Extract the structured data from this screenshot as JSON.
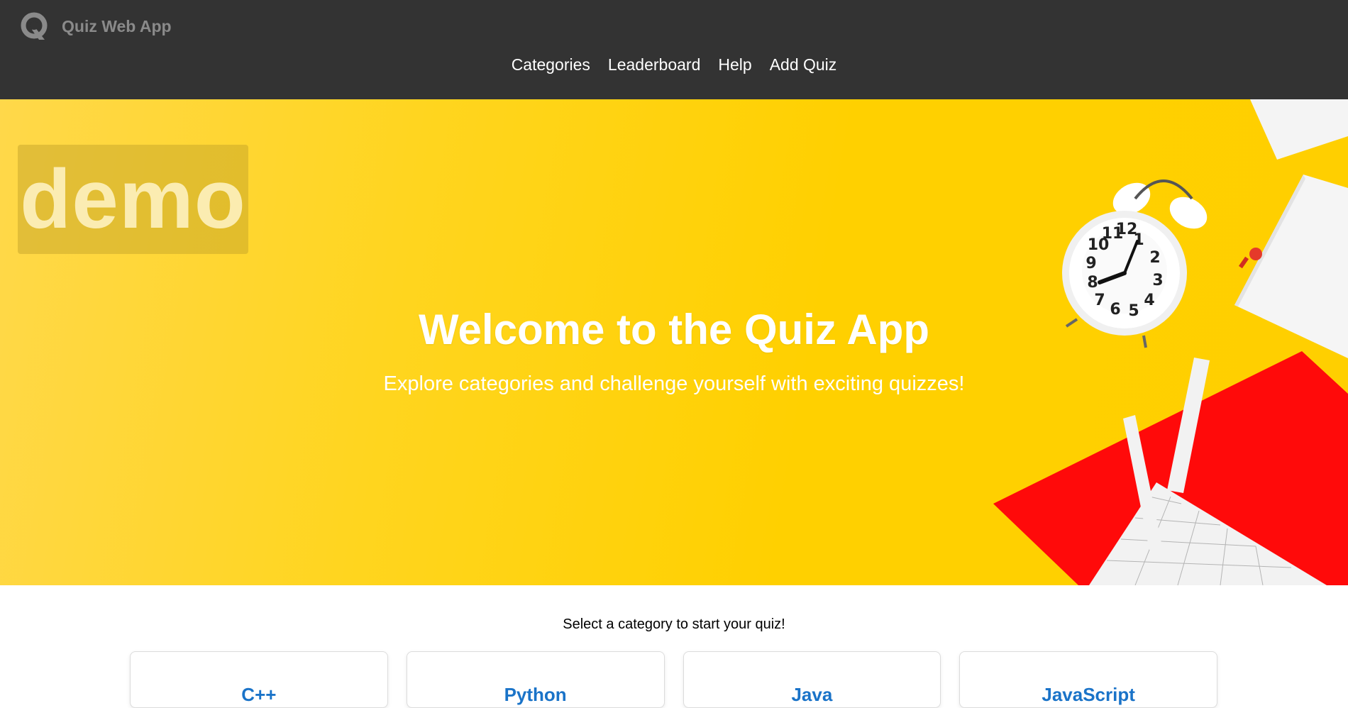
{
  "brand": {
    "name": "Quiz Web App",
    "logo_icon": "quiz-logo-icon"
  },
  "nav": {
    "items": [
      {
        "label": "Categories"
      },
      {
        "label": "Leaderboard"
      },
      {
        "label": "Help"
      },
      {
        "label": "Add Quiz"
      }
    ]
  },
  "hero": {
    "badge": "demo",
    "title": "Welcome to the Quiz App",
    "subtitle": "Explore categories and challenge yourself with exciting quizzes!"
  },
  "main": {
    "intro": "Select a category to start your quiz!",
    "categories": [
      {
        "title": "C++"
      },
      {
        "title": "Python"
      },
      {
        "title": "Java"
      },
      {
        "title": "JavaScript"
      }
    ]
  },
  "colors": {
    "navbar_bg": "#333333",
    "hero_yellow": "#ffd000",
    "link_blue": "#1a73c8"
  }
}
